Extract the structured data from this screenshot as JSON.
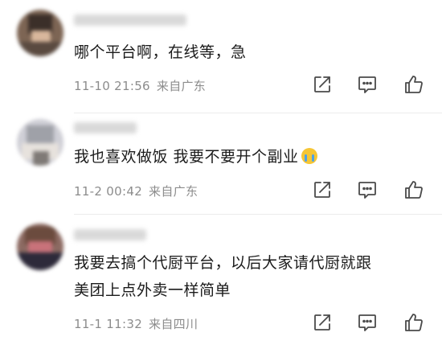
{
  "comments": [
    {
      "text": "哪个平台啊，在线等，急",
      "time": "11-10 21:56",
      "location": "来自广东",
      "avatar_colors": [
        "#3b2f29",
        "#8a6c58",
        "#d8b79c",
        "#5a4a40"
      ]
    },
    {
      "text": "我也喜欢做饭 我要不要开个副业",
      "time": "11-2 00:42",
      "location": "来自广东",
      "avatar_colors": [
        "#c9c9cf",
        "#9fa1a8",
        "#e7e2dd",
        "#7f7a76"
      ]
    },
    {
      "text_line1": "我要去搞个代厨平台，以后大家请代厨就跟",
      "text_line2": "美团上点外卖一样简单",
      "time": "11-1 11:32",
      "location": "来自四川",
      "avatar_colors": [
        "#6b4b3e",
        "#c8727a",
        "#2d2a3a",
        "#b4a39a"
      ]
    }
  ],
  "icons": {
    "share": "share-icon",
    "reply": "comment-icon",
    "like": "thumbs-up-icon"
  },
  "colors": {
    "text": "#1b1b1b",
    "meta": "#8c8c8c",
    "icon": "#4a4a4a"
  }
}
